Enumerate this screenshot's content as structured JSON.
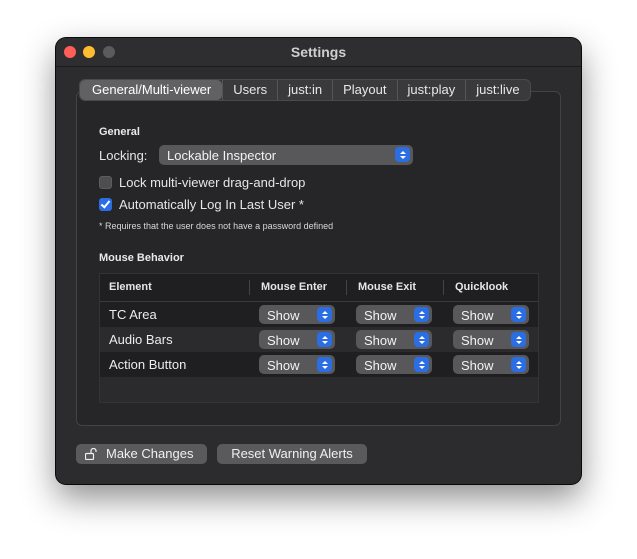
{
  "window": {
    "title": "Settings"
  },
  "tabs": [
    "General/Multi-viewer",
    "Users",
    "just:in",
    "Playout",
    "just:play",
    "just:live"
  ],
  "general": {
    "section_title": "General",
    "locking_label": "Locking:",
    "locking_value": "Lockable Inspector",
    "lock_drag_label": "Lock multi-viewer drag-and-drop",
    "lock_drag_checked": false,
    "auto_login_label": "Automatically Log In Last User *",
    "auto_login_checked": true,
    "footnote": "* Requires that the user does not have a password defined"
  },
  "mouse": {
    "section_title": "Mouse Behavior",
    "columns": [
      "Element",
      "Mouse Enter",
      "Mouse Exit",
      "Quicklook"
    ],
    "rows": [
      {
        "element": "TC Area",
        "enter": "Show",
        "exit": "Show",
        "quicklook": "Show"
      },
      {
        "element": "Audio Bars",
        "enter": "Show",
        "exit": "Show",
        "quicklook": "Show"
      },
      {
        "element": "Action Button",
        "enter": "Show",
        "exit": "Show",
        "quicklook": "Show"
      }
    ]
  },
  "buttons": {
    "make_changes": "Make Changes",
    "reset_alerts": "Reset Warning Alerts"
  },
  "icons": {
    "make_changes": "lock-open-icon",
    "popup": "up-down-chevron-icon"
  },
  "colors": {
    "accent": "#2b6de3",
    "close": "#ff5f57",
    "minimize": "#febc2e"
  }
}
